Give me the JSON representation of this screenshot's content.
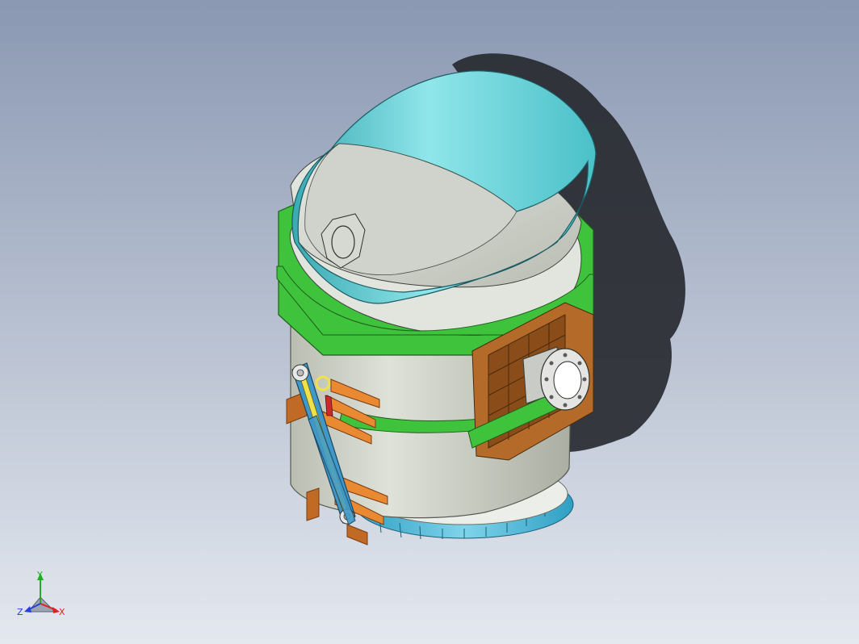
{
  "viewport": {
    "background_top": "#8a98b2",
    "background_bottom": "#e4e8ef",
    "shadow_color": "#25272c"
  },
  "model": {
    "colors": {
      "hood_outer": "#5fcfd6",
      "hood_inner": "#cfd4cc",
      "ring_green": "#3fc23c",
      "shell_gray": "#c8ccc0",
      "bracket_brown": "#b46a28",
      "fin_orange": "#e98a33",
      "link_blue": "#3f98c8",
      "link_yellow": "#f0e14b",
      "base_blue": "#4cb8d8",
      "flange_gray": "#d8d8d8"
    }
  },
  "triad": {
    "x_label": "X",
    "y_label": "Y",
    "z_label": "Z",
    "x_color": "#e02020",
    "y_color": "#1fb01f",
    "z_color": "#2a3fd8"
  }
}
